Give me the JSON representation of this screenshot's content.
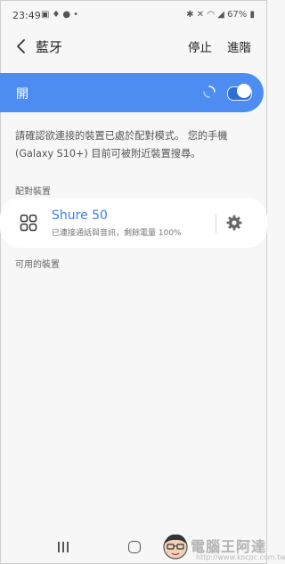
{
  "status_bar": {
    "time": "23:49",
    "left_icons": [
      "image-icon",
      "bulb-icon",
      "facebook-icon",
      "dot-icon"
    ],
    "right_text": "67%",
    "right_icons": [
      "bluetooth-icon",
      "mute-icon",
      "wifi-icon",
      "signal-icon",
      "battery-icon"
    ]
  },
  "header": {
    "title": "藍牙",
    "actions": {
      "stop": "停止",
      "advanced": "進階"
    }
  },
  "master_toggle": {
    "label": "開",
    "state": "on",
    "accent": "#4d8df1"
  },
  "info_text": "請確認欲連接的裝置已處於配對模式。 您的手機 (Galaxy S10+) 目前可被附近裝置搜尋。",
  "sections": {
    "paired": "配對裝置",
    "available": "可用的裝置"
  },
  "paired_devices": [
    {
      "name": "Shure 50",
      "status": "已連接通話與音訊，剩餘電量 100%",
      "icon": "device-grid-icon"
    }
  ],
  "watermark": {
    "text": "電腦王阿達",
    "url": "http://www.kocpc.com.tw"
  }
}
